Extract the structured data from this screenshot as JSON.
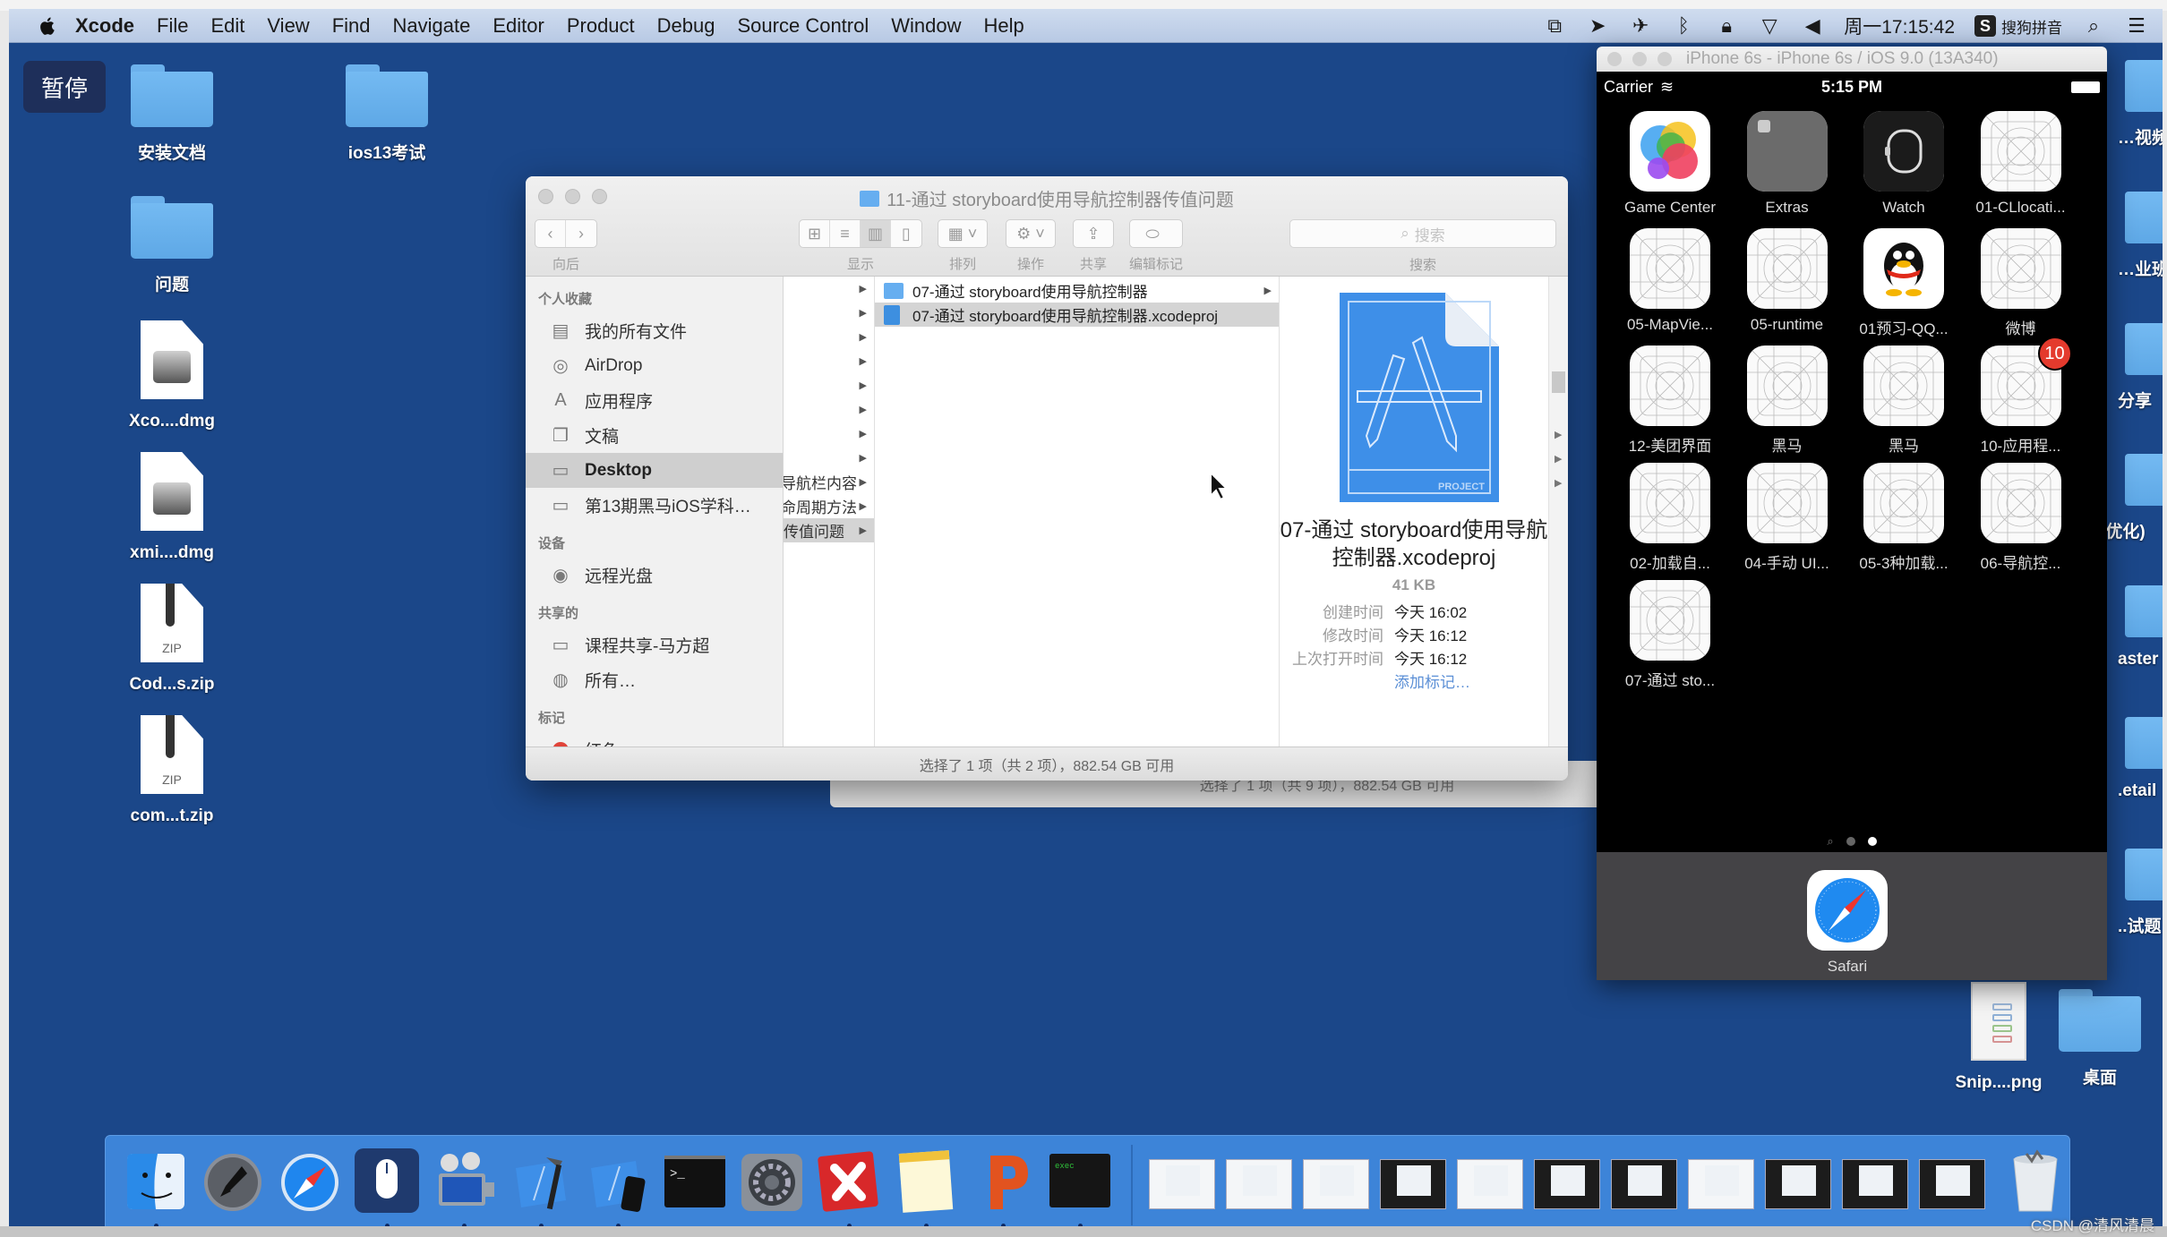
{
  "overlay": {
    "pause_label": "暂停",
    "watermark": "CSDN @清风清晨"
  },
  "menubar": {
    "app_name": "Xcode",
    "menus": [
      "File",
      "Edit",
      "View",
      "Find",
      "Navigate",
      "Editor",
      "Product",
      "Debug",
      "Source Control",
      "Window",
      "Help"
    ],
    "clock": "周一17:15:42",
    "input_method": "搜狗拼音",
    "status_icons": [
      "screen-record-icon",
      "location-icon",
      "airplane-icon",
      "bluetooth-icon",
      "lock-icon",
      "wifi-icon",
      "volume-icon"
    ]
  },
  "desktop": {
    "left_icons": [
      {
        "label": "安装文档",
        "type": "folder"
      },
      {
        "label": "ios13考试",
        "type": "folder"
      },
      {
        "label": "问题",
        "type": "folder"
      },
      {
        "label": "Xco....dmg",
        "type": "dmg"
      },
      {
        "label": "xmi....dmg",
        "type": "dmg"
      },
      {
        "label": "Cod...s.zip",
        "type": "zip",
        "badge": "ZIP"
      },
      {
        "label": "com...t.zip",
        "type": "zip",
        "badge": "ZIP"
      }
    ],
    "right_edge_labels": [
      "…视频",
      "…业班",
      "分享",
      "(优化)",
      "aster",
      ".etail",
      "..试题"
    ],
    "bottom_right_icons": [
      {
        "label": "Snip....png",
        "type": "png"
      },
      {
        "label": "桌面",
        "type": "folder"
      }
    ]
  },
  "finder": {
    "title": "11-通过 storyboard使用导航控制器传值问题",
    "toolbar": {
      "back_forward_label": "向后",
      "view_label": "显示",
      "arrange_label": "排列",
      "action_label": "操作",
      "share_label": "共享",
      "tags_label": "编辑标记",
      "search_placeholder": "搜索",
      "search_label": "搜索"
    },
    "sidebar": {
      "favorites_header": "个人收藏",
      "favorites": [
        {
          "label": "我的所有文件",
          "icon": "all-files-icon"
        },
        {
          "label": "AirDrop",
          "icon": "airdrop-icon"
        },
        {
          "label": "应用程序",
          "icon": "applications-icon"
        },
        {
          "label": "文稿",
          "icon": "documents-icon"
        },
        {
          "label": "Desktop",
          "icon": "desktop-icon",
          "selected": true
        },
        {
          "label": "第13期黑马iOS学科…",
          "icon": "folder-icon"
        }
      ],
      "devices_header": "设备",
      "devices": [
        {
          "label": "远程光盘",
          "icon": "remote-disc-icon"
        }
      ],
      "shared_header": "共享的",
      "shared": [
        {
          "label": "课程共享-马方超",
          "icon": "computer-icon"
        },
        {
          "label": "所有…",
          "icon": "network-icon"
        }
      ],
      "tags_header": "标记",
      "tags": [
        {
          "label": "红色",
          "color": "#e0443a"
        }
      ]
    },
    "column1": {
      "rows": [
        "",
        "",
        "",
        "",
        "",
        "",
        "",
        "",
        "导航栏内容",
        "生命周期方法",
        "传值问题"
      ],
      "selected_index": 10
    },
    "column2": {
      "rows": [
        {
          "label": "07-通过 storyboard使用导航控制器",
          "type": "folder",
          "has_children": true
        },
        {
          "label": "07-通过 storyboard使用导航控制器.xcodeproj",
          "type": "xcodeproj",
          "selected": true
        }
      ]
    },
    "preview": {
      "icon_caption": "PROJECT",
      "name": "07-通过 storyboard使用导航控制器.xcodeproj",
      "size": "41 KB",
      "meta": [
        {
          "key": "创建时间",
          "value": "今天 16:02"
        },
        {
          "key": "修改时间",
          "value": "今天 16:12"
        },
        {
          "key": "上次打开时间",
          "value": "今天 16:12"
        }
      ],
      "add_tags_link": "添加标记…"
    },
    "status": "选择了 1 项（共 2 项），882.54 GB 可用"
  },
  "finder_back": {
    "status": "选择了 1 项（共 9 项），882.54 GB 可用"
  },
  "simulator": {
    "title": "iPhone 6s - iPhone 6s / iOS 9.0 (13A340)",
    "carrier": "Carrier",
    "time": "5:15 PM",
    "apps": [
      {
        "label": "Game Center",
        "kind": "gamecenter"
      },
      {
        "label": "Extras",
        "kind": "extras"
      },
      {
        "label": "Watch",
        "kind": "watch"
      },
      {
        "label": "01-CLlocati...",
        "kind": "placeholder"
      },
      {
        "label": "05-MapVie...",
        "kind": "placeholder"
      },
      {
        "label": "05-runtime",
        "kind": "placeholder"
      },
      {
        "label": "01预习-QQ...",
        "kind": "qq"
      },
      {
        "label": "微博",
        "kind": "placeholder"
      },
      {
        "label": "12-美团界面",
        "kind": "placeholder"
      },
      {
        "label": "黑马",
        "kind": "placeholder"
      },
      {
        "label": "黑马",
        "kind": "placeholder"
      },
      {
        "label": "10-应用程...",
        "kind": "placeholder",
        "badge": "10"
      },
      {
        "label": "02-加载自...",
        "kind": "placeholder"
      },
      {
        "label": "04-手动 UI...",
        "kind": "placeholder"
      },
      {
        "label": "05-3种加载...",
        "kind": "placeholder"
      },
      {
        "label": "06-导航控...",
        "kind": "placeholder"
      },
      {
        "label": "07-通过 sto...",
        "kind": "placeholder"
      }
    ],
    "page_count": 2,
    "current_page": 2,
    "dock_app": {
      "label": "Safari"
    }
  },
  "dock": {
    "apps": [
      {
        "name": "Finder",
        "icon": "finder-icon",
        "running": true
      },
      {
        "name": "Launchpad",
        "icon": "launchpad-icon",
        "running": false
      },
      {
        "name": "Safari",
        "icon": "safari-icon",
        "running": false
      },
      {
        "name": "Mouse Utility",
        "icon": "mouse-icon",
        "running": true
      },
      {
        "name": "Screen Recorder",
        "icon": "movie-recorder-icon",
        "running": true
      },
      {
        "name": "Xcode",
        "icon": "xcode-icon",
        "running": true
      },
      {
        "name": "Simulator",
        "icon": "simulator-icon",
        "running": true
      },
      {
        "name": "Terminal",
        "icon": "terminal-icon",
        "running": false
      },
      {
        "name": "System Preferences",
        "icon": "system-preferences-icon",
        "running": false
      },
      {
        "name": "XMind",
        "icon": "xmind-icon",
        "running": true
      },
      {
        "name": "Notes",
        "icon": "notes-icon",
        "running": true
      },
      {
        "name": "Keynote",
        "icon": "presentation-icon",
        "running": true
      },
      {
        "name": "Exec Console",
        "icon": "console-icon",
        "running": true
      }
    ],
    "minimized_windows": 11,
    "trash": "Trash"
  }
}
